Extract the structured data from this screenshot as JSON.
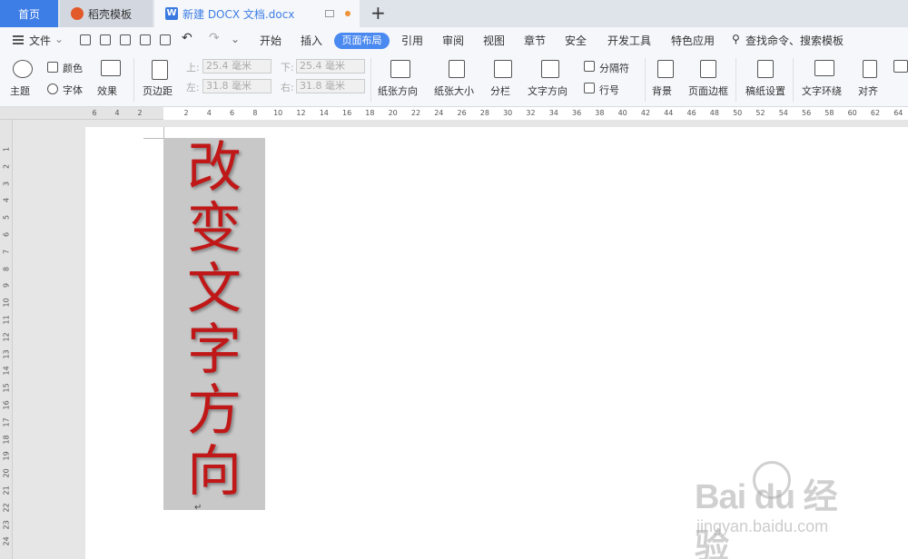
{
  "tabs": {
    "home": "首页",
    "template": "稻壳模板",
    "document": "新建 DOCX 文档.docx",
    "doc_icon_letter": "W",
    "add": "+"
  },
  "menu": {
    "file": "文件",
    "items": [
      "开始",
      "插入",
      "页面布局",
      "引用",
      "审阅",
      "视图",
      "章节",
      "安全",
      "开发工具",
      "特色应用"
    ],
    "active": "页面布局",
    "search": "查找命令、搜索模板"
  },
  "ribbon": {
    "theme": "主题",
    "color": "颜色",
    "font": "字体",
    "effect": "效果",
    "margins": "页边距",
    "top_label": "上:",
    "top_value": "25.4 毫米",
    "bottom_label": "下:",
    "bottom_value": "25.4 毫米",
    "left_label": "左:",
    "left_value": "31.8 毫米",
    "right_label": "右:",
    "right_value": "31.8 毫米",
    "orientation": "纸张方向",
    "size": "纸张大小",
    "columns": "分栏",
    "text_direction": "文字方向",
    "breaks": "分隔符",
    "line_numbers": "行号",
    "background": "背景",
    "page_border": "页面边框",
    "manuscript": "稿纸设置",
    "wrap_text": "文字环绕",
    "align": "对齐"
  },
  "ruler": {
    "left_ticks": [
      "6",
      "4",
      "2"
    ],
    "ticks": [
      "2",
      "4",
      "6",
      "8",
      "10",
      "12",
      "14",
      "16",
      "18",
      "20",
      "22",
      "24",
      "26",
      "28",
      "30",
      "32",
      "34",
      "36",
      "38",
      "40",
      "42",
      "44",
      "46",
      "48",
      "50",
      "52",
      "54",
      "56",
      "58",
      "60",
      "62",
      "64"
    ],
    "vertical_ticks": [
      "1",
      "2",
      "3",
      "4",
      "5",
      "6",
      "7",
      "8",
      "9",
      "10",
      "11",
      "12",
      "13",
      "14",
      "15",
      "16",
      "17",
      "18",
      "19",
      "20",
      "21",
      "22",
      "23",
      "24"
    ]
  },
  "document": {
    "vertical_text": [
      "改",
      "变",
      "文",
      "字",
      "方",
      "向"
    ],
    "text_color": "#c01818"
  },
  "watermark": {
    "logo": "Bai du 经验",
    "url": "jingyan.baidu.com"
  }
}
